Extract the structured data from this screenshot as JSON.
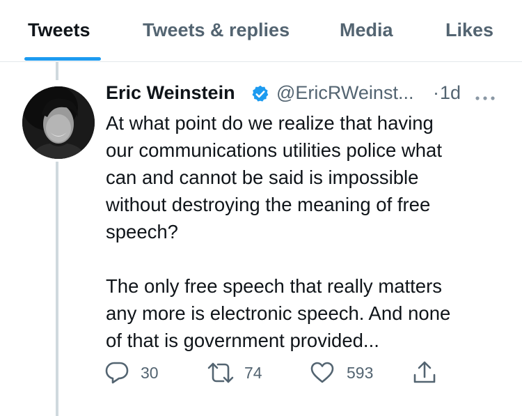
{
  "tabs": [
    {
      "label": "Tweets",
      "active": true
    },
    {
      "label": "Tweets & replies",
      "active": false
    },
    {
      "label": "Media",
      "active": false
    },
    {
      "label": "Likes",
      "active": false
    }
  ],
  "tweet": {
    "author_name": "Eric Weinstein",
    "verified": true,
    "handle": "@EricRWeinst...",
    "separator": "·",
    "timestamp": "1d",
    "text": "At what point do we realize that having\nour communications utilities police what\ncan and cannot be said is impossible\nwithout destroying the meaning of free\nspeech?\n\nThe only free speech that really matters\nany more is electronic speech. And none\nof that is government provided...",
    "actions": {
      "reply_count": "30",
      "retweet_count": "74",
      "like_count": "593"
    }
  },
  "icons": {
    "verified": "verified-badge-icon",
    "more": "more-horizontal-icon",
    "reply": "reply-icon",
    "retweet": "retweet-icon",
    "like": "heart-icon",
    "share": "share-icon"
  },
  "colors": {
    "accent": "#1d9bf0",
    "text_primary": "#0f1419",
    "text_secondary": "#536471",
    "divider": "#e4e8eb",
    "thread_line": "#cfd9de"
  }
}
